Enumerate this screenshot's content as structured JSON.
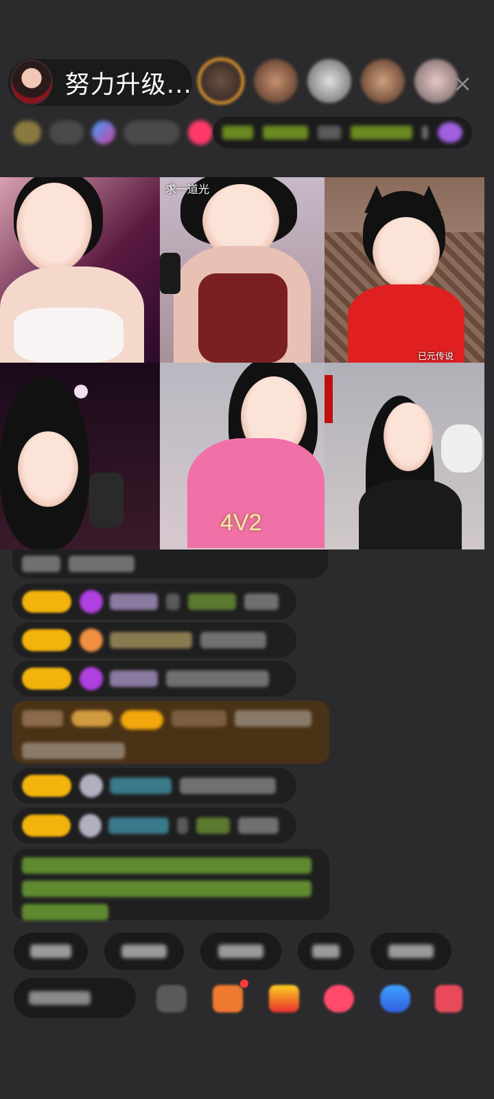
{
  "header": {
    "host_name": "努力升级...",
    "close_icon": "×"
  },
  "video_grid": {
    "tile_labels": {
      "tile_2": "求一道光",
      "tile_3": "已元传说",
      "tile_5": "4V2"
    }
  },
  "colors": {
    "background": "#2b2b2d",
    "pill_background": "#1a1a1b",
    "level_badge": "#f2b30c",
    "gift_message_bg": "#5a3e1a",
    "system_text": "#8fd14f"
  }
}
